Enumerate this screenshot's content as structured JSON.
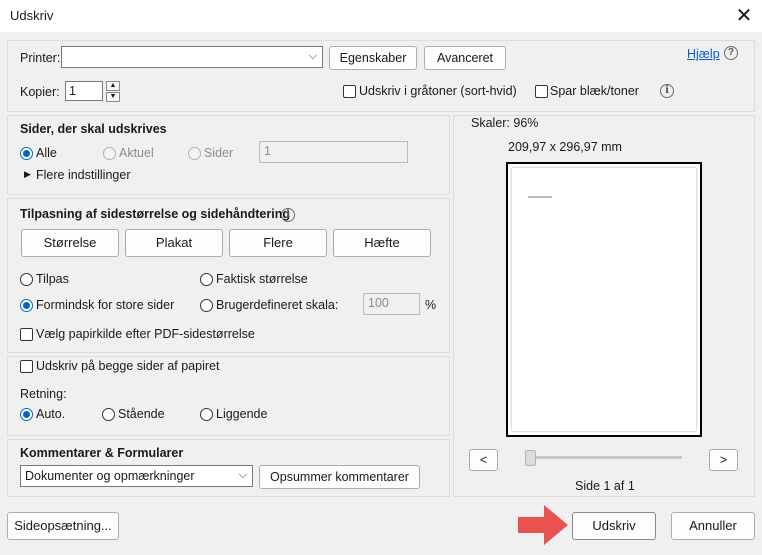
{
  "window": {
    "title": "Udskriv",
    "close_glyph": "✕"
  },
  "printer": {
    "label": "Printer:",
    "value": "",
    "properties_button": "Egenskaber",
    "advanced_button": "Avanceret",
    "help_link": "Hjælp",
    "copies_label": "Kopier:",
    "copies_value": "1",
    "grayscale_label": "Udskriv i gråtoner (sort-hvid)",
    "grayscale_checked": false,
    "save_ink_label": "Spar blæk/toner",
    "save_ink_checked": false
  },
  "pages": {
    "heading": "Sider, der skal udskrives",
    "all_label": "Alle",
    "current_label": "Aktuel",
    "pages_label": "Sider",
    "pages_value": "1",
    "more_settings": "Flere indstillinger"
  },
  "sizing": {
    "heading": "Tilpasning af sidestørrelse og sidehåndtering",
    "tabs": [
      "Størrelse",
      "Plakat",
      "Flere",
      "Hæfte"
    ],
    "fit_label": "Tilpas",
    "actual_size_label": "Faktisk størrelse",
    "shrink_label": "Formindsk for store sider",
    "custom_scale_label": "Brugerdefineret skala:",
    "custom_scale_value": "100",
    "percent": "%",
    "paper_source_label": "Vælg papirkilde efter PDF-sidestørrelse"
  },
  "duplex": {
    "both_sides_label": "Udskriv på begge sider af papiret",
    "orientation_label": "Retning:",
    "auto_label": "Auto.",
    "portrait_label": "Stående",
    "landscape_label": "Liggende"
  },
  "comments": {
    "heading": "Kommentarer & Formularer",
    "select_value": "Dokumenter og opmærkninger",
    "summarize_button": "Opsummer kommentarer"
  },
  "preview": {
    "scale_text": "Skaler:  96%",
    "dimensions": "209,97 x 296,97 mm",
    "prev_button": "<",
    "next_button": ">",
    "page_text": "Side 1 af 1",
    "page_progress": 0
  },
  "footer": {
    "page_setup_button": "Sideopsætning...",
    "print_button": "Udskriv",
    "cancel_button": "Annuller"
  },
  "colors": {
    "accent": "#0067c0",
    "arrow": "#e8524f",
    "link": "#0b5cd7"
  }
}
